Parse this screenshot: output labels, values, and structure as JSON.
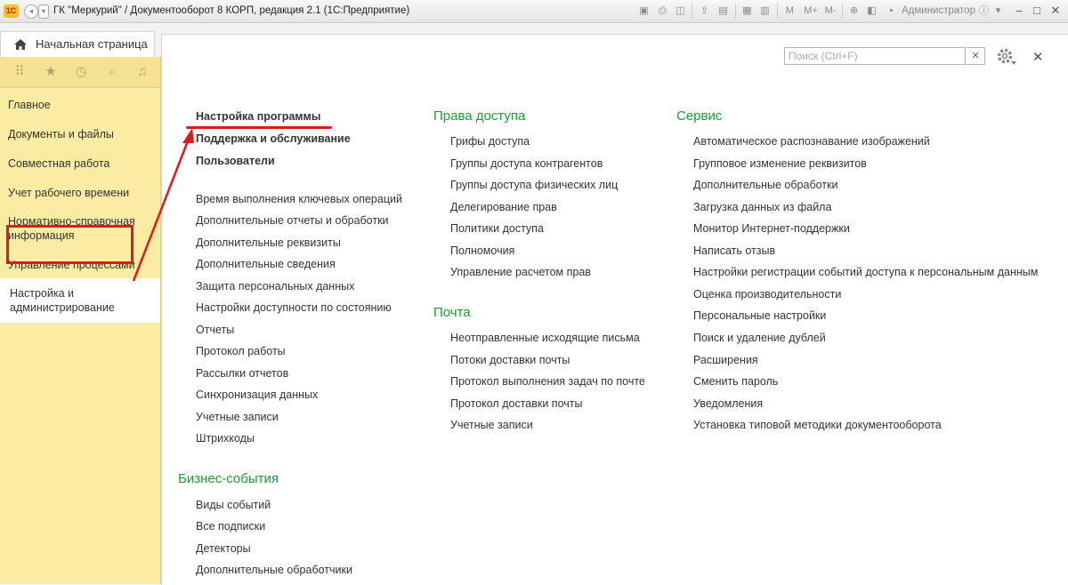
{
  "window": {
    "title": "ГК \"Меркурий\" / Документооборот 8 КОРП, редакция 2.1  (1С:Предприятие)",
    "logo": "1С",
    "user": "Администратор",
    "toolbar_labels": [
      "M",
      "M+",
      "M-"
    ]
  },
  "tabs": {
    "home_label": "Начальная страница"
  },
  "sidebar": {
    "items": [
      {
        "label": "Главное"
      },
      {
        "label": "Документы и файлы"
      },
      {
        "label": "Совместная работа"
      },
      {
        "label": "Учет рабочего времени"
      },
      {
        "label": "Нормативно-справочная информация"
      },
      {
        "label": "Управление процессами"
      },
      {
        "label": "Настройка и администрирование"
      }
    ],
    "active_index": 6
  },
  "search": {
    "placeholder": "Поиск (Ctrl+F)",
    "value": ""
  },
  "col1": {
    "bold_links": [
      "Настройка программы",
      "Поддержка и обслуживание",
      "Пользователи"
    ],
    "links": [
      "Время выполнения ключевых операций",
      "Дополнительные отчеты и обработки",
      "Дополнительные реквизиты",
      "Дополнительные сведения",
      "Защита персональных данных",
      "Настройки доступности по состоянию",
      "Отчеты",
      "Протокол работы",
      "Рассылки отчетов",
      "Синхронизация данных",
      "Учетные записи",
      "Штрихкоды"
    ],
    "biz_title": "Бизнес-события",
    "biz_links": [
      "Виды событий",
      "Все подписки",
      "Детекторы",
      "Дополнительные обработчики"
    ]
  },
  "col2": {
    "access_title": "Права доступа",
    "access_links": [
      "Грифы доступа",
      "Группы доступа контрагентов",
      "Группы доступа физических лиц",
      "Делегирование прав",
      "Политики доступа",
      "Полномочия",
      "Управление расчетом прав"
    ],
    "mail_title": "Почта",
    "mail_links": [
      "Неотправленные исходящие письма",
      "Потоки доставки почты",
      "Протокол выполнения задач по почте",
      "Протокол доставки почты",
      "Учетные записи"
    ]
  },
  "col3": {
    "service_title": "Сервис",
    "service_links": [
      "Автоматическое распознавание изображений",
      "Групповое изменение реквизитов",
      "Дополнительные обработки",
      "Загрузка данных из файла",
      "Монитор Интернет-поддержки",
      "Написать отзыв",
      "Настройки регистрации событий доступа к персональным данным",
      "Оценка производительности",
      "Персональные настройки",
      "Поиск и удаление дублей",
      "Расширения",
      "Сменить пароль",
      "Уведомления",
      "Установка типовой методики документооборота"
    ]
  },
  "colors": {
    "accent_green": "#15a031",
    "highlight_red": "#e01a1a",
    "sidebar_bg": "#fbeca3"
  }
}
